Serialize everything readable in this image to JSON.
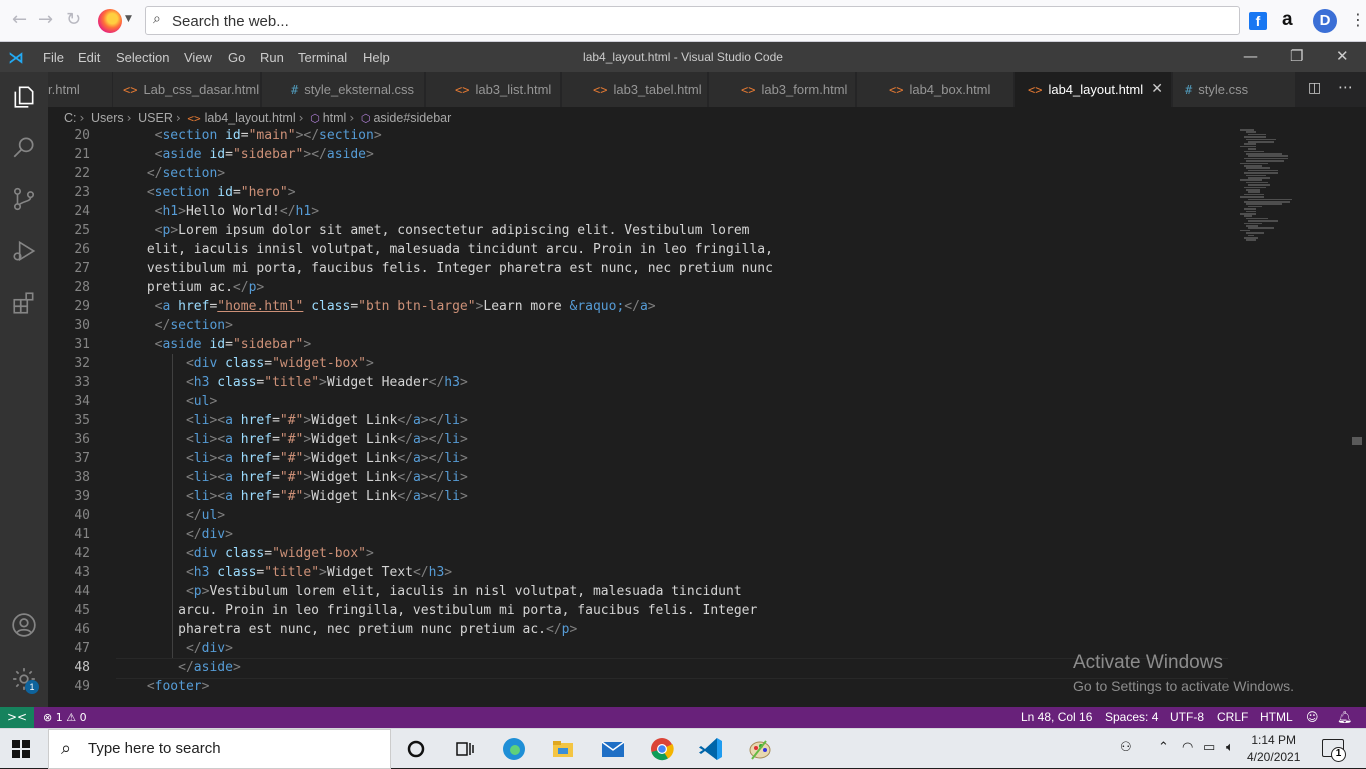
{
  "firefox": {
    "search_placeholder": "Search the web...",
    "back_glyph": "←",
    "forward_glyph": "→",
    "reload_glyph": "↻",
    "ext_facebook": "f",
    "ext_amazon": "a",
    "ext_d": "D"
  },
  "titlebar": {
    "menus": [
      "File",
      "Edit",
      "Selection",
      "View",
      "Go",
      "Run",
      "Terminal",
      "Help"
    ],
    "window_title": "lab4_layout.html - Visual Studio Code",
    "minimize": "—",
    "restore": "❐",
    "close": "✕"
  },
  "tabs": [
    {
      "icon": "<>",
      "type": "html",
      "label": "r.html"
    },
    {
      "icon": "<>",
      "type": "html",
      "label": "Lab_css_dasar.html"
    },
    {
      "icon": "#",
      "type": "css",
      "label": "style_eksternal.css"
    },
    {
      "icon": "<>",
      "type": "html",
      "label": "lab3_list.html"
    },
    {
      "icon": "<>",
      "type": "html",
      "label": "lab3_tabel.html"
    },
    {
      "icon": "<>",
      "type": "html",
      "label": "lab3_form.html"
    },
    {
      "icon": "<>",
      "type": "html",
      "label": "lab4_box.html"
    },
    {
      "icon": "<>",
      "type": "html",
      "label": "lab4_layout.html",
      "active": true,
      "close": "✕"
    },
    {
      "icon": "#",
      "type": "css",
      "label": "style.css"
    }
  ],
  "breadcrumb": {
    "items": [
      "C:",
      "Users",
      "USER",
      "lab4_layout.html",
      "html",
      "aside#sidebar"
    ]
  },
  "editor": {
    "current_line": 48,
    "lines": [
      {
        "n": 20,
        "code": "  <section id=\"main\"></section>"
      },
      {
        "n": 21,
        "code": "  <aside id=\"sidebar\"></aside>"
      },
      {
        "n": 22,
        "code": " </section>"
      },
      {
        "n": 23,
        "code": " <section id=\"hero\">"
      },
      {
        "n": 24,
        "code": "  <h1>Hello World!</h1>"
      },
      {
        "n": 25,
        "code": "  <p>Lorem ipsum dolor sit amet, consectetur adipiscing elit. Vestibulum lorem"
      },
      {
        "n": 26,
        "code": " elit, iaculis innisl volutpat, malesuada tincidunt arcu. Proin in leo fringilla,"
      },
      {
        "n": 27,
        "code": " vestibulum mi porta, faucibus felis. Integer pharetra est nunc, nec pretium nunc"
      },
      {
        "n": 28,
        "code": " pretium ac.</p>"
      },
      {
        "n": 29,
        "code": "  <a href=\"home.html\" class=\"btn btn-large\">Learn more &raquo;</a>"
      },
      {
        "n": 30,
        "code": "  </section>"
      },
      {
        "n": 31,
        "code": "  <aside id=\"sidebar\">"
      },
      {
        "n": 32,
        "code": "      <div class=\"widget-box\">"
      },
      {
        "n": 33,
        "code": "      <h3 class=\"title\">Widget Header</h3>"
      },
      {
        "n": 34,
        "code": "      <ul>"
      },
      {
        "n": 35,
        "code": "      <li><a href=\"#\">Widget Link</a></li>"
      },
      {
        "n": 36,
        "code": "      <li><a href=\"#\">Widget Link</a></li>"
      },
      {
        "n": 37,
        "code": "      <li><a href=\"#\">Widget Link</a></li>"
      },
      {
        "n": 38,
        "code": "      <li><a href=\"#\">Widget Link</a></li>"
      },
      {
        "n": 39,
        "code": "      <li><a href=\"#\">Widget Link</a></li>"
      },
      {
        "n": 40,
        "code": "      </ul>"
      },
      {
        "n": 41,
        "code": "      </div>"
      },
      {
        "n": 42,
        "code": "      <div class=\"widget-box\">"
      },
      {
        "n": 43,
        "code": "      <h3 class=\"title\">Widget Text</h3>"
      },
      {
        "n": 44,
        "code": "      <p>Vestibulum lorem elit, iaculis in nisl volutpat, malesuada tincidunt"
      },
      {
        "n": 45,
        "code": "     arcu. Proin in leo fringilla, vestibulum mi porta, faucibus felis. Integer"
      },
      {
        "n": 46,
        "code": "     pharetra est nunc, nec pretium nunc pretium ac.</p>"
      },
      {
        "n": 47,
        "code": "      </div>"
      },
      {
        "n": 48,
        "code": "     </aside>"
      },
      {
        "n": 49,
        "code": " <footer>"
      }
    ]
  },
  "watermark": {
    "title": "Activate Windows",
    "subtitle": "Go to Settings to activate Windows."
  },
  "statusbar": {
    "remote": "><",
    "problems": "⊗ 1 ⚠ 0",
    "position": "Ln 48, Col 16",
    "spaces": "Spaces: 4",
    "encoding": "UTF-8",
    "eol": "CRLF",
    "language": "HTML"
  },
  "taskbar": {
    "search_placeholder": "Type here to search",
    "time": "1:14 PM",
    "date": "4/20/2021",
    "notification_count": "1",
    "settings_badge": "1"
  },
  "colors": {
    "status_bar": "#68217a",
    "activity_bar": "#333333",
    "editor_bg": "#1e1e1e",
    "tag": "#569cd6",
    "attribute": "#9cdcfe",
    "string": "#ce9178"
  }
}
